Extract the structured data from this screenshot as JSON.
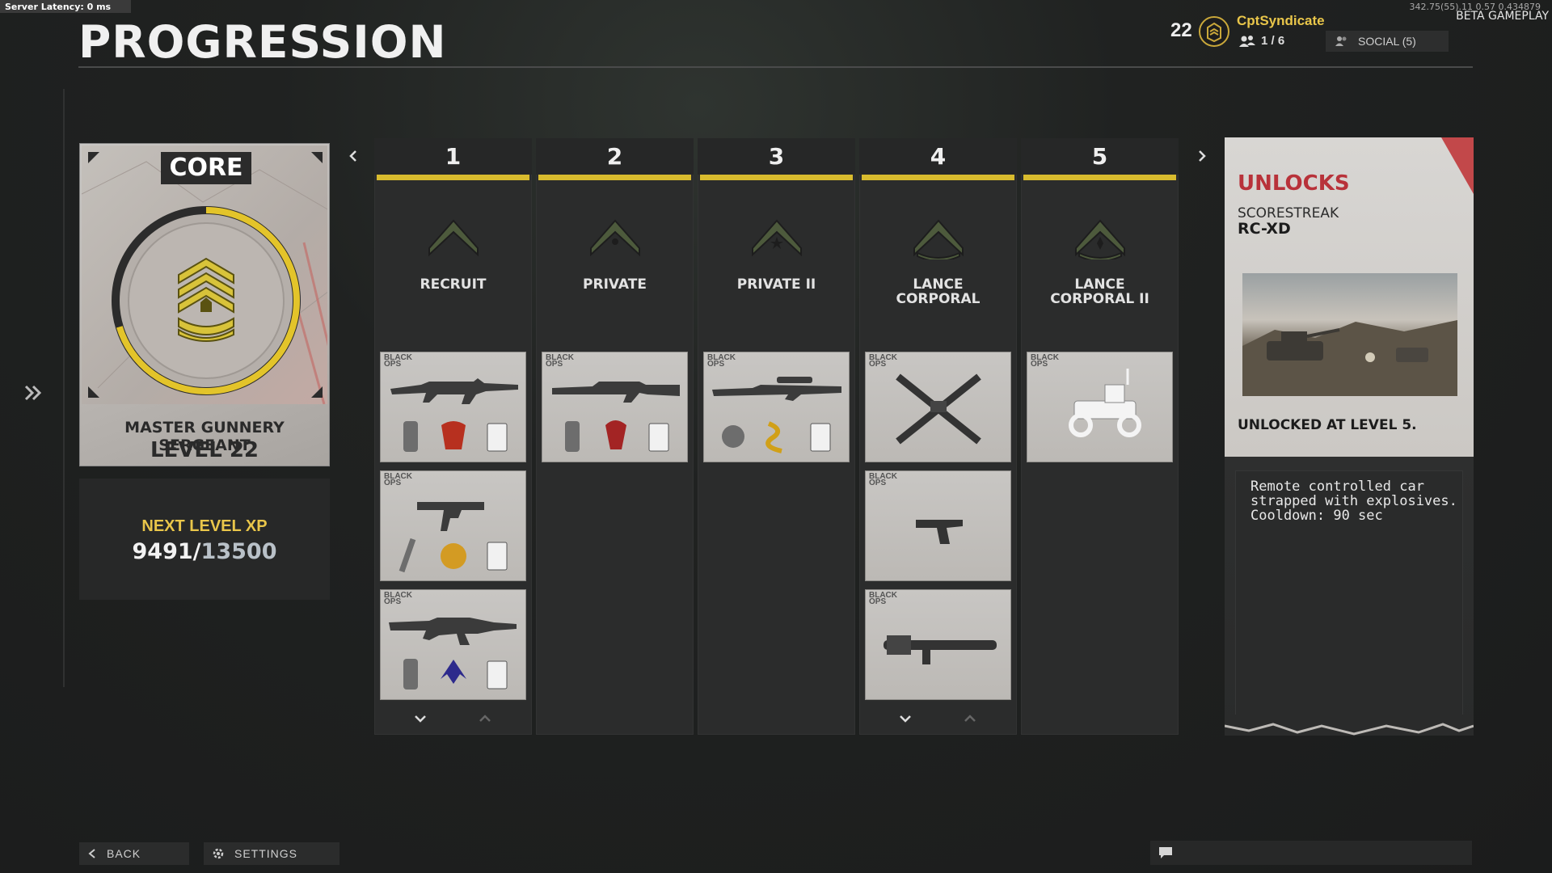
{
  "server": {
    "latency": "Server Latency: 0 ms",
    "coords": "342.75(55).11 0.57 0.434879",
    "mode": "BETA GAMEPLAY"
  },
  "page": {
    "title": "PROGRESSION"
  },
  "player": {
    "level": "22",
    "name": "CptSyndicate",
    "party": "1 / 6",
    "social_label": "SOCIAL (5)"
  },
  "core": {
    "label": "CORE",
    "rank_name": "MASTER GUNNERY SERGEANT",
    "level_text": "LEVEL 22",
    "level_progress": 0.703
  },
  "xp": {
    "label": "NEXT LEVEL XP",
    "current": "9491",
    "separator": "/",
    "max": "13500"
  },
  "columns": [
    {
      "number": "1",
      "rank_line1": "RECRUIT",
      "rank_line2": "",
      "items": 3,
      "show_scroll": true
    },
    {
      "number": "2",
      "rank_line1": "PRIVATE",
      "rank_line2": "",
      "items": 1,
      "show_scroll": false
    },
    {
      "number": "3",
      "rank_line1": "PRIVATE II",
      "rank_line2": "",
      "items": 1,
      "show_scroll": false
    },
    {
      "number": "4",
      "rank_line1": "LANCE",
      "rank_line2": "CORPORAL",
      "items": 3,
      "show_scroll": true
    },
    {
      "number": "5",
      "rank_line1": "LANCE",
      "rank_line2": "CORPORAL II",
      "items": 1,
      "show_scroll": false
    }
  ],
  "item_brand": {
    "line1": "BLACK",
    "line2": "OPS"
  },
  "unlocks": {
    "title": "UNLOCKS",
    "type": "SCORESTREAK",
    "name": "RC-XD",
    "unlocked_at": "UNLOCKED AT LEVEL 5.",
    "description": "Remote controlled car strapped with explosives. Cooldown: 90 sec"
  },
  "footer": {
    "back_label": "BACK",
    "settings_label": "SETTINGS"
  },
  "colors": {
    "accent_yellow": "#d8bb2e",
    "gold_text": "#e9c64a",
    "unlock_red": "#b8323a"
  }
}
